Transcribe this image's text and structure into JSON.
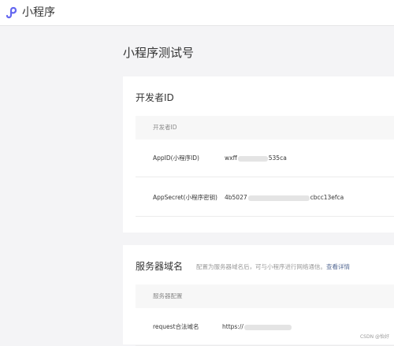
{
  "app": {
    "brand": "小程序",
    "logo_icon": "mini-program-logo-icon"
  },
  "page": {
    "title": "小程序测试号"
  },
  "developer_id": {
    "title": "开发者ID",
    "table_header": "开发者ID",
    "rows": [
      {
        "key": "AppID(小程序ID)",
        "value_prefix": "wxff",
        "value_suffix": "535ca"
      },
      {
        "key": "AppSecret(小程序密钥)",
        "value_prefix": "4b5027",
        "value_suffix": "cbcc13efca"
      }
    ]
  },
  "server_domain": {
    "title": "服务器域名",
    "description": "配置为服务器域名后，可与小程序进行网络通信。",
    "link_label": "查看详情",
    "table_header": "服务器配置",
    "rows": [
      {
        "key": "request合法域名",
        "value_prefix": "https://"
      }
    ]
  },
  "watermark": "CSDN @怡好",
  "colors": {
    "link": "#576b95",
    "mask": "#e4e4e4"
  }
}
